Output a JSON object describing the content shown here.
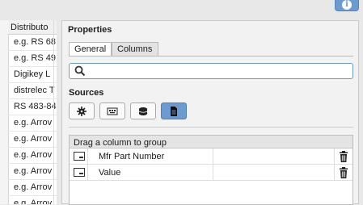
{
  "left_table": {
    "header": "Distributo",
    "rows": [
      "e.g. RS 68",
      "e.g.  RS 49",
      "Digikey  L",
      "distrelec  T",
      "RS 483-84",
      "e.g. Arrov",
      "e.g. Arrov",
      "e.g. Arrov",
      "e.g. Arrov",
      "e.g. Arrov",
      "e.g. Arrov"
    ]
  },
  "info_button": {
    "icon": "info-icon"
  },
  "properties": {
    "title": "Properties",
    "tabs": [
      {
        "label": "General",
        "active": true
      },
      {
        "label": "Columns",
        "active": false
      }
    ],
    "search": {
      "value": "",
      "placeholder": ""
    },
    "sources_label": "Sources",
    "sources": [
      {
        "icon": "component-icon",
        "active": false
      },
      {
        "icon": "chip-icon",
        "active": false
      },
      {
        "icon": "database-icon",
        "active": false
      },
      {
        "icon": "document-icon",
        "active": true
      }
    ],
    "group_header": "Drag a column to group",
    "columns": [
      {
        "label": "Mfr Part Number"
      },
      {
        "label": "Value"
      }
    ]
  },
  "colors": {
    "accent": "#6c9bd2",
    "panel_bg": "#f2f2f2"
  }
}
